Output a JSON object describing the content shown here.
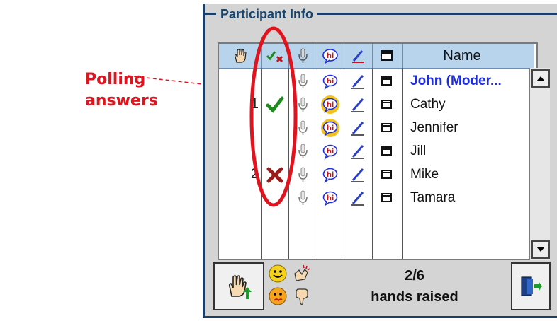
{
  "callout": {
    "line1": "Polling",
    "line2": "answers"
  },
  "panel": {
    "title": "Participant Info"
  },
  "table": {
    "columns": [
      {
        "icon": "raised-hand-icon"
      },
      {
        "icon": "poll-check-x-icon"
      },
      {
        "icon": "microphone-icon"
      },
      {
        "icon": "chat-hi-icon"
      },
      {
        "icon": "pen-icon"
      },
      {
        "icon": "window-icon"
      },
      {
        "label": "Name"
      }
    ],
    "rows": [
      {
        "name": "John (Moder...",
        "moderator": true,
        "hand": "",
        "poll": "",
        "chat_active": false
      },
      {
        "name": "Cathy",
        "moderator": false,
        "hand": "1",
        "poll": "check",
        "chat_active": true
      },
      {
        "name": "Jennifer",
        "moderator": false,
        "hand": "",
        "poll": "",
        "chat_active": true
      },
      {
        "name": "Jill",
        "moderator": false,
        "hand": "",
        "poll": "",
        "chat_active": false
      },
      {
        "name": "Mike",
        "moderator": false,
        "hand": "2",
        "poll": "x",
        "chat_active": false
      },
      {
        "name": "Tamara",
        "moderator": false,
        "hand": "",
        "poll": "",
        "chat_active": false
      }
    ]
  },
  "status": {
    "count": "2/6",
    "label": "hands raised"
  },
  "colors": {
    "accent_red": "#e0141e",
    "panel_border": "#1c3f66",
    "header_blue": "#b8d4ec",
    "moderator_blue": "#1d2ce0",
    "check_green": "#1f8a1f",
    "x_red": "#9b1b1b",
    "chat_active_fill": "#f3c21a"
  }
}
